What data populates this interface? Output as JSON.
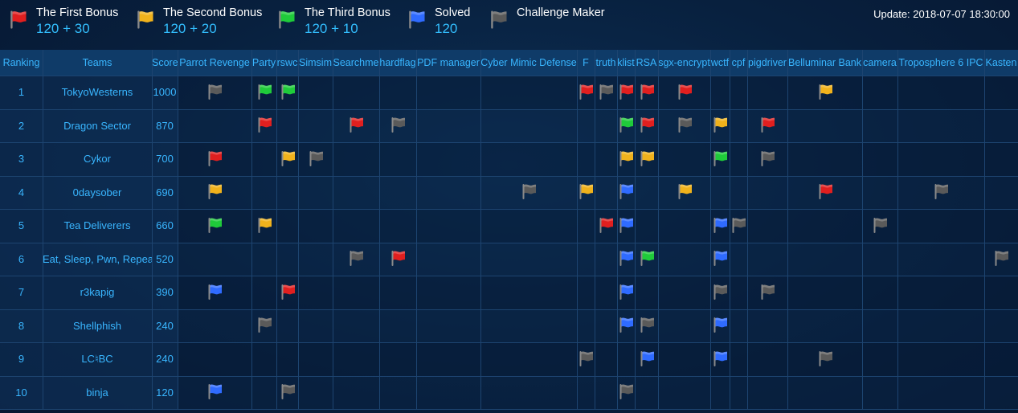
{
  "legend": [
    {
      "name": "The First Bonus",
      "points": "120 + 30",
      "color": "#e01f1f",
      "icon": "flag-red-icon"
    },
    {
      "name": "The Second Bonus",
      "points": "120 + 20",
      "color": "#f0b21c",
      "icon": "flag-yellow-icon"
    },
    {
      "name": "The Third Bonus",
      "points": "120 + 10",
      "color": "#1fcb3a",
      "icon": "flag-green-icon"
    },
    {
      "name": "Solved",
      "points": "120",
      "color": "#2f6bff",
      "icon": "flag-blue-icon"
    },
    {
      "name": "Challenge Maker",
      "points": "",
      "color": "#5a5a5a",
      "icon": "flag-gray-icon"
    }
  ],
  "update": "Update: 2018-07-07 18:30:00",
  "headers": [
    "Ranking",
    "Teams",
    "Score",
    "Parrot Revenge",
    "Party",
    "rswc",
    "Simsim",
    "Searchme",
    "hardflag",
    "PDF manager",
    "Cyber Mimic Defense",
    "F",
    "truth",
    "klist",
    "RSA",
    "sgx-encrypt",
    "wctf",
    "cpf",
    "pigdriver",
    "Belluminar Bank",
    "camera",
    "Troposphere 6 IPC",
    "Kasten"
  ],
  "teams": [
    {
      "rank": "1",
      "name": "TokyoWesterns",
      "score": "1000",
      "flags": {
        "3": "gray",
        "4": "green",
        "5": "green",
        "11": "red",
        "12": "gray",
        "13": "red",
        "14": "red",
        "15": "red",
        "19": "yellow"
      }
    },
    {
      "rank": "2",
      "name": "Dragon Sector",
      "score": "870",
      "flags": {
        "4": "red",
        "7": "red",
        "8": "gray",
        "13": "green",
        "14": "red",
        "15": "gray",
        "16": "yellow",
        "18": "red"
      }
    },
    {
      "rank": "3",
      "name": "Cykor",
      "score": "700",
      "flags": {
        "3": "red",
        "5": "yellow",
        "6": "gray",
        "13": "yellow",
        "14": "yellow",
        "16": "green",
        "18": "gray"
      }
    },
    {
      "rank": "4",
      "name": "0daysober",
      "score": "690",
      "flags": {
        "3": "yellow",
        "10": "gray",
        "11": "yellow",
        "13": "blue",
        "15": "yellow",
        "19": "red",
        "21": "gray"
      }
    },
    {
      "rank": "5",
      "name": "Tea Deliverers",
      "score": "660",
      "flags": {
        "3": "green",
        "4": "yellow",
        "12": "red",
        "13": "blue",
        "16": "blue",
        "17": "gray",
        "20": "gray"
      }
    },
    {
      "rank": "6",
      "name": "Eat, Sleep, Pwn, Repeat",
      "score": "520",
      "flags": {
        "7": "gray",
        "8": "red",
        "13": "blue",
        "14": "green",
        "16": "blue",
        "22": "gray"
      }
    },
    {
      "rank": "7",
      "name": "r3kapig",
      "score": "390",
      "flags": {
        "3": "blue",
        "5": "red",
        "13": "blue",
        "16": "gray",
        "18": "gray"
      }
    },
    {
      "rank": "8",
      "name": "Shellphish",
      "score": "240",
      "flags": {
        "4": "gray",
        "13": "blue",
        "14": "gray",
        "16": "blue"
      }
    },
    {
      "rank": "9",
      "name": "LC♮BC",
      "score": "240",
      "flags": {
        "11": "gray",
        "14": "blue",
        "16": "blue",
        "19": "gray"
      }
    },
    {
      "rank": "10",
      "name": "binja",
      "score": "120",
      "flags": {
        "3": "blue",
        "5": "gray",
        "13": "gray"
      }
    }
  ],
  "colors": {
    "red": "#e01f1f",
    "yellow": "#f0b21c",
    "green": "#1fcb3a",
    "blue": "#2f6bff",
    "gray": "#5a5a5a",
    "accent": "#39b6ff",
    "header_bg": "#0f3b68",
    "grid": "#1d4470"
  }
}
